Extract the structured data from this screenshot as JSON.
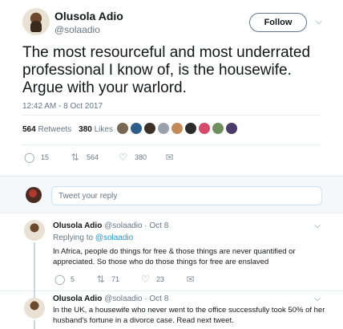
{
  "tweet": {
    "author_name": "Olusola Adio",
    "author_handle": "@solaadio",
    "follow_label": "Follow",
    "text": "The most resourceful and most underrated professional I know of, is the housewife. Argue with your warlord.",
    "timestamp": "12:42 AM - 8 Oct 2017",
    "retweets_count": "564",
    "retweets_label": "Retweets",
    "likes_count": "380",
    "likes_label": "Likes",
    "actions": {
      "replies": "15",
      "retweets": "564",
      "likes": "380"
    }
  },
  "reply_box": {
    "placeholder": "Tweet your reply"
  },
  "replies": [
    {
      "author_name": "Olusola Adio",
      "author_handle": "@solaadio",
      "date": "Oct 8",
      "replying_prefix": "Replying to",
      "replying_handle": "@solaadio",
      "text": "In Africa, people do things for free & those things are never quantified or appreciated. So those who do those things for free are enslaved",
      "actions": {
        "replies": "5",
        "retweets": "71",
        "likes": "23"
      }
    },
    {
      "author_name": "Olusola Adio",
      "author_handle": "@solaadio",
      "date": "Oct 8",
      "text": "In the UK, a housewife who never went to the office successfully took 50% of her husband's fortune in a divorce case. Read next tweet."
    }
  ],
  "icons": {
    "reply": "reply-icon",
    "retweet": "retweet-icon",
    "like": "heart-icon",
    "message": "message-icon",
    "more": "chevron-down-icon"
  },
  "colors": {
    "accent": "#1b95e0",
    "muted": "#657786",
    "text": "#14171a",
    "border": "#e6ecf0"
  }
}
